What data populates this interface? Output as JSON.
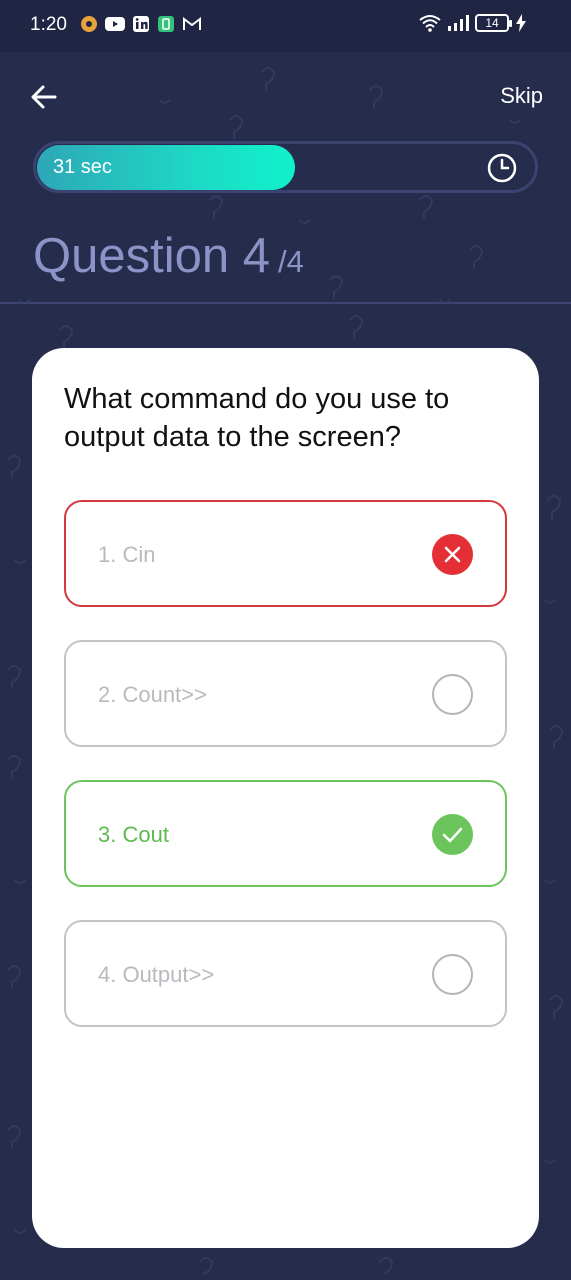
{
  "status_bar": {
    "time": "1:20",
    "battery_level": "14",
    "icons": [
      "notification-dot-icon",
      "youtube-icon",
      "linkedin-icon",
      "battery-saver-icon",
      "gmail-icon",
      "wifi-icon",
      "signal-icon",
      "battery-icon",
      "charging-icon"
    ]
  },
  "header": {
    "back_icon": "arrow-left-icon",
    "skip_label": "Skip"
  },
  "timer": {
    "label": "31 sec",
    "progress": 0.52,
    "icon": "clock-icon",
    "colors": {
      "start": "#2EA7B8",
      "end": "#10F2CC",
      "track": "#3B4470"
    }
  },
  "question": {
    "heading": "Question 4",
    "total": "/4",
    "text": "What command do you use to output data to the screen?"
  },
  "options": [
    {
      "label": "1. Cin",
      "state": "wrong"
    },
    {
      "label": "2. Count>>",
      "state": "unselected"
    },
    {
      "label": "3. Cout",
      "state": "correct"
    },
    {
      "label": "4. Output>>",
      "state": "unselected"
    }
  ],
  "colors": {
    "background": "#252C4C",
    "status_bar": "#1F2542",
    "heading": "#8C93C6",
    "wrong": "#E32F35",
    "correct": "#6CC55C"
  }
}
